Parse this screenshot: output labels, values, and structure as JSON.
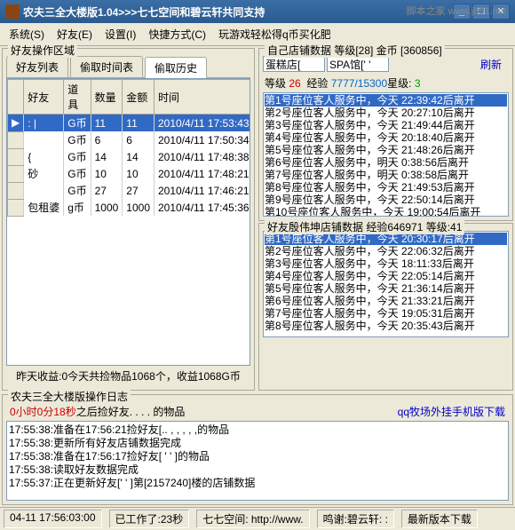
{
  "title": "农夫三全大楼版1.04>>>七七空间和碧云轩共同支持",
  "watermark": "脚本之家\nwww.jb51.net",
  "menu": [
    "系统(S)",
    "好友(E)",
    "设置(I)",
    "快捷方式(C)",
    "玩游戏轻松得q币买化肥"
  ],
  "left": {
    "title": "好友操作区域",
    "tabs": [
      "好友列表",
      "偷取时间表",
      "偷取历史"
    ],
    "tabActive": 2,
    "cols": [
      "好友",
      "道具",
      "数量",
      "金额",
      "时间"
    ],
    "rows": [
      {
        "f": ": |",
        "d": "G币",
        "q": "11",
        "j": "11",
        "t": "2010/4/11 17:53:43",
        "sel": true
      },
      {
        "f": "",
        "d": "G币",
        "q": "6",
        "j": "6",
        "t": "2010/4/11 17:50:34"
      },
      {
        "f": "{",
        "d": "G币",
        "q": "14",
        "j": "14",
        "t": "2010/4/11 17:48:38"
      },
      {
        "f": "砂",
        "d": "G币",
        "q": "10",
        "j": "10",
        "t": "2010/4/11 17:48:21"
      },
      {
        "f": "",
        "d": "G币",
        "q": "27",
        "j": "27",
        "t": "2010/4/11 17:46:21"
      },
      {
        "f": "包租婆",
        "d": "g币",
        "q": "1000",
        "j": "1000",
        "t": "2010/4/11 17:45:36"
      }
    ],
    "footer": "昨天收益:0今天共捡物品1068个，收益1068G币"
  },
  "right": {
    "shopTitle": "自己店铺数据 等级[28] 金币 [360856]",
    "shop1": "蛋糕店[",
    "shop2": "SPA馆[' ' ",
    "refresh": "刷新",
    "stats": {
      "lv": "26",
      "exp": "7777/15300",
      "star": "3",
      "lvLbl": "等级",
      "expLbl": "经验",
      "starLbl": "星级:"
    },
    "seats1": [
      "第1号座位客人服务中，今天 22:39:42后离开",
      "第2号座位客人服务中，今天 20:27:10后离开",
      "第3号座位客人服务中，今天 21:49:44后离开",
      "第4号座位客人服务中，今天 20:18:40后离开",
      "第5号座位客人服务中，今天 21:48:26后离开",
      "第6号座位客人服务中，明天 0:38:56后离开",
      "第7号座位客人服务中，明天 0:38:58后离开",
      "第8号座位客人服务中，今天 21:49:53后离开",
      "第9号座位客人服务中，今天 22:50:14后离开",
      "第10号座位客人服务中，今天 19:00:54后离开"
    ],
    "friendTitle": "好友殷伟坤店铺数据 经验646971 等级:41",
    "seats2": [
      "第1号座位客人服务中，今天 20:30:17后离开",
      "第2号座位客人服务中，今天 22:06:32后离开",
      "第3号座位客人服务中，今天 18:11:33后离开",
      "第4号座位客人服务中，今天 22:05:14后离开",
      "第5号座位客人服务中，今天 21:36:14后离开",
      "第6号座位客人服务中，今天 21:33:21后离开",
      "第7号座位客人服务中，今天 19:05:31后离开",
      "第8号座位客人服务中，今天 20:35:43后离开"
    ]
  },
  "log": {
    "title": "农夫三全大楼版操作日志",
    "timer": "0小时0分18秒",
    "timerAfter": "之后捡好友. .    . . 的物品",
    "link": "qq牧场外挂手机版下载",
    "lines": [
      "17:55:38:准备在17:56:21捡好友[.. , , , , ,的物品",
      "17:55:38:更新所有好友店铺数据完成",
      "17:55:38:准备在17:56:17捡好友[    ' '  ]的物品",
      "17:55:38:读取好友数据完成",
      "17:55:37:正在更新好友['   ' ]第[2157240]楼的店铺数据"
    ]
  },
  "status": {
    "time": "04-11 17:56:03:00",
    "work": "已工作了:23秒",
    "qq": "七七空间: http://www.",
    "ming": "鸣谢:碧云轩: :",
    "ver": "最新版本下载"
  }
}
